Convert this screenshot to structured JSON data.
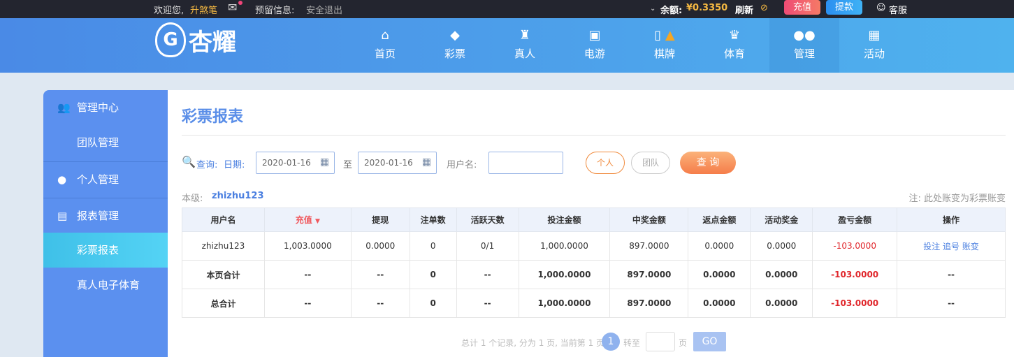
{
  "topbar": {
    "welcome": "欢迎您,",
    "username": "升煞笔",
    "reserved": "预留信息:",
    "logout": "安全退出",
    "balance_label": "余额:",
    "balance": "¥0.3350",
    "refresh": "刷新",
    "recharge": "充值",
    "withdraw": "提款",
    "service": "客服"
  },
  "logo": {
    "text": "杏耀"
  },
  "nav": [
    {
      "label": "首页",
      "icon": "home-icon"
    },
    {
      "label": "彩票",
      "icon": "ticket-icon"
    },
    {
      "label": "真人",
      "icon": "dealer-icon"
    },
    {
      "label": "电游",
      "icon": "slot-icon"
    },
    {
      "label": "棋牌",
      "icon": "mahjong-icon"
    },
    {
      "label": "体育",
      "icon": "trophy-icon"
    },
    {
      "label": "管理",
      "icon": "users-icon"
    },
    {
      "label": "活动",
      "icon": "gift-icon"
    }
  ],
  "sidebar": [
    {
      "label": "管理中心"
    },
    {
      "label": "团队管理"
    },
    {
      "label": "个人管理"
    },
    {
      "label": "报表管理"
    },
    {
      "label": "彩票报表"
    },
    {
      "label": "真人电子体育"
    }
  ],
  "page": {
    "title": "彩票报表",
    "query_label": "查询:",
    "date_label": "日期:",
    "date_from": "2020-01-16",
    "to": "至",
    "date_to": "2020-01-16",
    "user_label": "用户名:",
    "user_value": "",
    "personal": "个人",
    "team": "团队",
    "search": "查 询",
    "level_label": "本级:",
    "level_user": "zhizhu123",
    "note": "注: 此处账变为彩票账变"
  },
  "table": {
    "headers": [
      "用户名",
      "充值",
      "提现",
      "注单数",
      "活跃天数",
      "投注金额",
      "中奖金额",
      "返点金额",
      "活动奖金",
      "盈亏金额",
      "操作"
    ],
    "rows": [
      [
        "zhizhu123",
        "1,003.0000",
        "0.0000",
        "0",
        "0/1",
        "1,000.0000",
        "897.0000",
        "0.0000",
        "0.0000",
        "-103.0000",
        ""
      ],
      [
        "本页合计",
        "--",
        "--",
        "0",
        "--",
        "1,000.0000",
        "897.0000",
        "0.0000",
        "0.0000",
        "-103.0000",
        "--"
      ],
      [
        "总合计",
        "--",
        "--",
        "0",
        "--",
        "1,000.0000",
        "897.0000",
        "0.0000",
        "0.0000",
        "-103.0000",
        "--"
      ]
    ],
    "actions": [
      "投注",
      "追号",
      "账变"
    ]
  },
  "pager": {
    "summary": "总计 1 个记录, 分为 1 页, 当前第 1 页",
    "current": "1",
    "goto": "转至",
    "page_unit": "页",
    "go": "GO"
  }
}
